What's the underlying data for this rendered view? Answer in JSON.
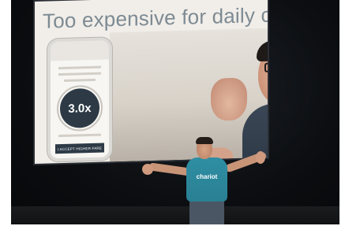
{
  "slide": {
    "title": "Too expensive for daily comm",
    "phone": {
      "multiplier": "3.0x",
      "button_label": "I ACCEPT HIGHER FARE"
    }
  },
  "speaker": {
    "shirt_text": "chariot"
  },
  "colors": {
    "slide_background": "#f1eee9",
    "slide_title": "#7d8a93",
    "shirt_teal": "#2f8fa3",
    "stage_dark": "#0b0d10"
  }
}
